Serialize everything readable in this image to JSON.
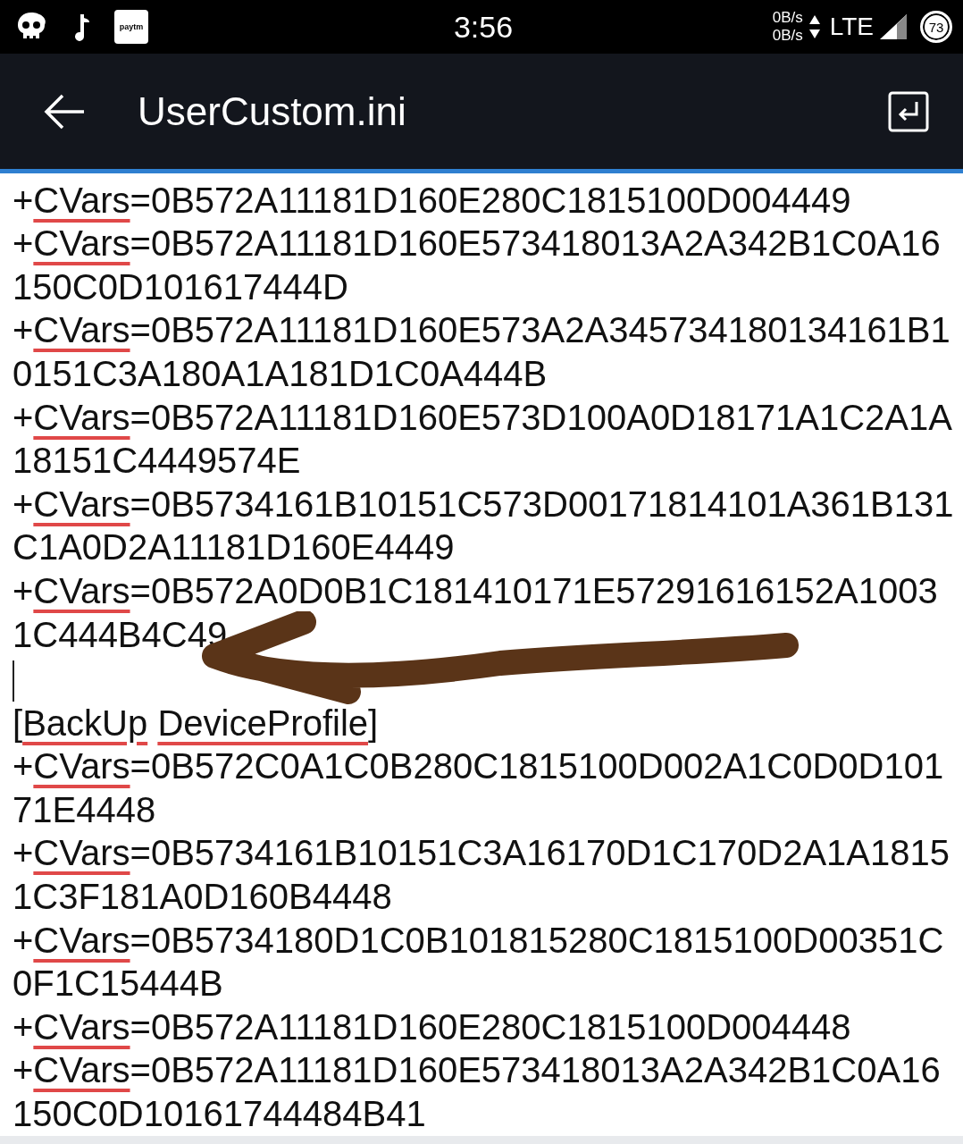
{
  "status_bar": {
    "logo": "paytm",
    "time": "3:56",
    "upload_speed": "0B/s",
    "download_speed": "0B/s",
    "network": "LTE",
    "battery": "73"
  },
  "app_bar": {
    "title": "UserCustom.ini"
  },
  "lines": [
    {
      "kind": "entry",
      "tokens": [
        {
          "text": "+",
          "flagged": false
        },
        {
          "text": "CVars",
          "flagged": true
        },
        {
          "text": "=0B572A11181D160E280C1815100D004449",
          "flagged": false
        }
      ]
    },
    {
      "kind": "entry",
      "tokens": [
        {
          "text": "+",
          "flagged": false
        },
        {
          "text": "CVars",
          "flagged": true
        },
        {
          "text": "=0B572A11181D160E573418013A2A342B1C0A16150C0D101617444D",
          "flagged": false
        }
      ]
    },
    {
      "kind": "entry",
      "tokens": [
        {
          "text": "+",
          "flagged": false
        },
        {
          "text": "CVars",
          "flagged": true
        },
        {
          "text": "=0B572A11181D160E573A2A345734180134161B10151C3A180A1A181D1C0A444B",
          "flagged": false
        }
      ]
    },
    {
      "kind": "entry",
      "tokens": [
        {
          "text": "+",
          "flagged": false
        },
        {
          "text": "CVars",
          "flagged": true
        },
        {
          "text": "=0B572A11181D160E573D100A0D18171A1C2A1A18151C4449574E",
          "flagged": false
        }
      ]
    },
    {
      "kind": "entry",
      "tokens": [
        {
          "text": "+",
          "flagged": false
        },
        {
          "text": "CVars",
          "flagged": true
        },
        {
          "text": "=0B5734161B10151C573D00171814101A361B131C1A0D2A11181D160E4449",
          "flagged": false
        }
      ]
    },
    {
      "kind": "entry",
      "tokens": [
        {
          "text": "+",
          "flagged": false
        },
        {
          "text": "CVars",
          "flagged": true
        },
        {
          "text": "=0B572A0D0B1C181410171E57291616152A10031C444B4C49",
          "flagged": false
        }
      ]
    },
    {
      "kind": "cursor"
    },
    {
      "kind": "section",
      "open": "[",
      "close": "]",
      "words": [
        {
          "text": "BackUp",
          "flagged": true
        },
        {
          "text": "DeviceProfile",
          "flagged": true
        }
      ]
    },
    {
      "kind": "entry",
      "tokens": [
        {
          "text": "+",
          "flagged": false
        },
        {
          "text": "CVars",
          "flagged": true
        },
        {
          "text": "=0B572C0A1C0B280C1815100D002A1C0D0D10171E4448",
          "flagged": false
        }
      ]
    },
    {
      "kind": "entry",
      "tokens": [
        {
          "text": "+",
          "flagged": false
        },
        {
          "text": "CVars",
          "flagged": true
        },
        {
          "text": "=0B5734161B10151C3A16170D1C170D2A1A18151C3F181A0D160B4448",
          "flagged": false
        }
      ]
    },
    {
      "kind": "entry",
      "tokens": [
        {
          "text": "+",
          "flagged": false
        },
        {
          "text": "CVars",
          "flagged": true
        },
        {
          "text": "=0B5734180D1C0B101815280C1815100D00351C0F1C15444B",
          "flagged": false
        }
      ]
    },
    {
      "kind": "entry",
      "tokens": [
        {
          "text": "+",
          "flagged": false
        },
        {
          "text": "CVars",
          "flagged": true
        },
        {
          "text": "=0B572A11181D160E280C1815100D004448",
          "flagged": false
        }
      ]
    },
    {
      "kind": "entry",
      "tokens": [
        {
          "text": "+",
          "flagged": false
        },
        {
          "text": "CVars",
          "flagged": true
        },
        {
          "text": "=0B572A11181D160E573418013A2A342B1C0A16150C0D10161744484B41",
          "flagged": false
        }
      ]
    }
  ]
}
